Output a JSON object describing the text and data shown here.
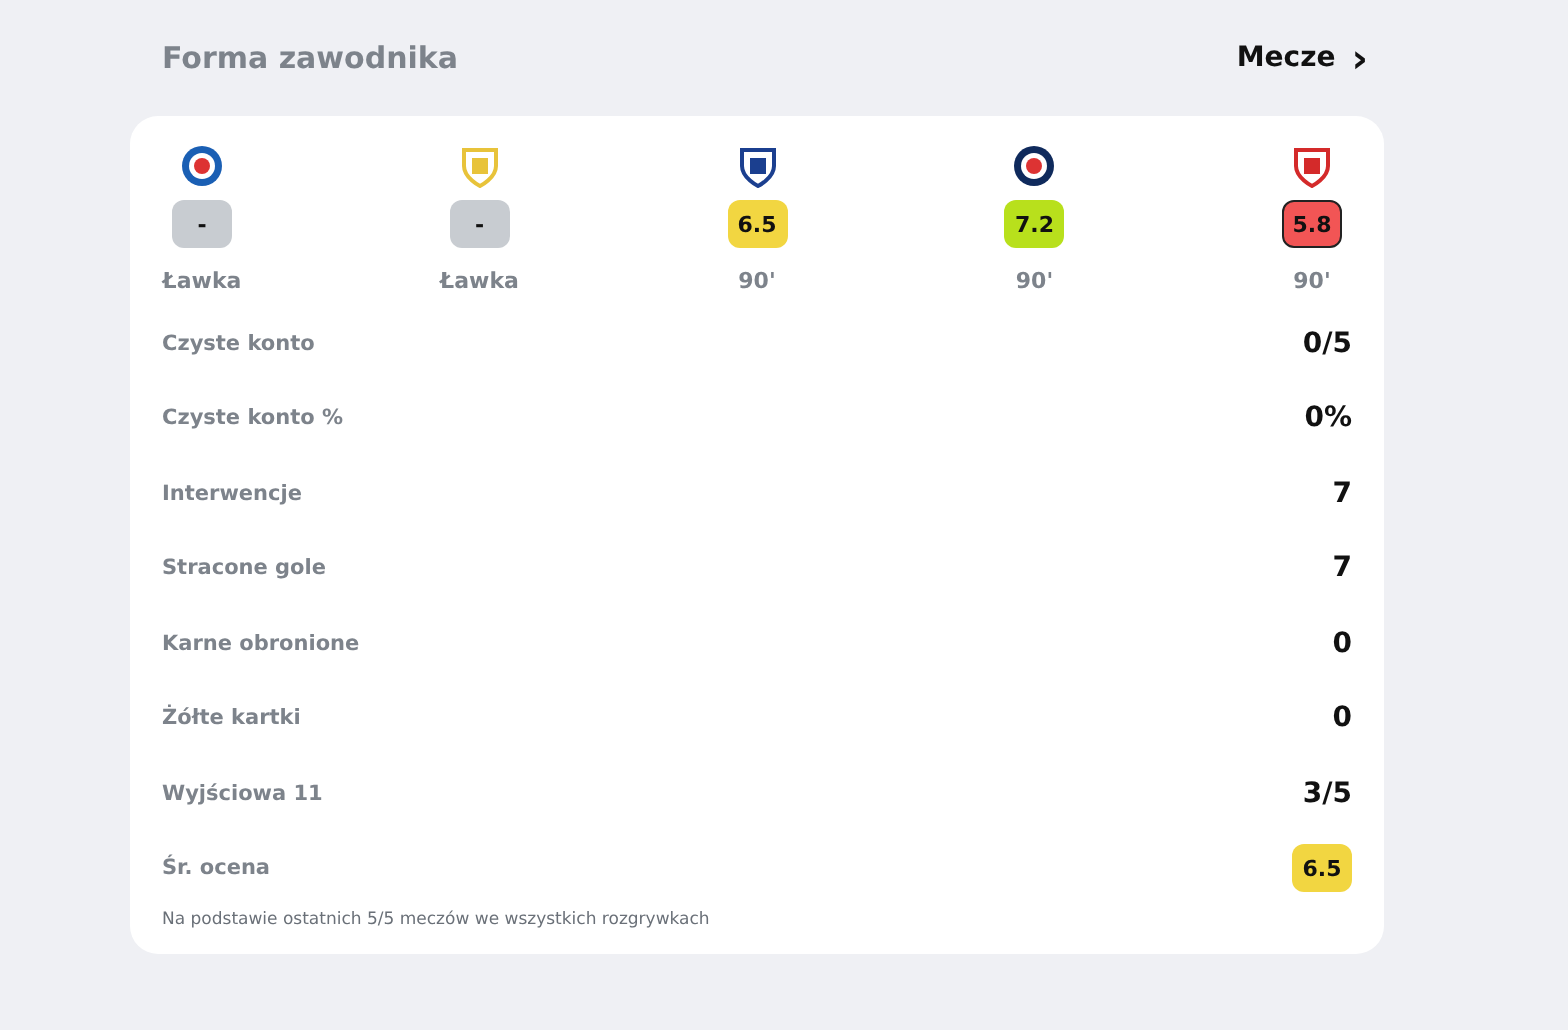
{
  "title": "Forma zawodnika",
  "link": {
    "label": "Mecze",
    "icon": "›"
  },
  "matches": [
    {
      "rating": "-",
      "color": "#c8ccd1",
      "highlighted": false,
      "minutes": "Ławka"
    },
    {
      "rating": "-",
      "color": "#c8ccd1",
      "highlighted": false,
      "minutes": "Ławka"
    },
    {
      "rating": "6.5",
      "color": "#f2d641",
      "highlighted": false,
      "minutes": "90'"
    },
    {
      "rating": "7.2",
      "color": "#b8e01c",
      "highlighted": false,
      "minutes": "90'"
    },
    {
      "rating": "5.8",
      "color": "#f25555",
      "highlighted": true,
      "minutes": "90'"
    }
  ],
  "stats": [
    {
      "label": "Czyste konto",
      "value": "0/5",
      "kind": "text"
    },
    {
      "label": "Czyste konto %",
      "value": "0%",
      "kind": "text"
    },
    {
      "label": "Interwencje",
      "value": "7",
      "kind": "text"
    },
    {
      "label": "Stracone gole",
      "value": "7",
      "kind": "text"
    },
    {
      "label": "Karne obronione",
      "value": "0",
      "kind": "text"
    },
    {
      "label": "Żółte kartki",
      "value": "0",
      "kind": "text"
    },
    {
      "label": "Wyjściowa 11",
      "value": "3/5",
      "kind": "text"
    },
    {
      "label": "Śr. ocena",
      "value": "6.5",
      "kind": "badge",
      "color": "#f2d641"
    }
  ],
  "footnote": "Na podstawie ostatnich 5/5 meczów we wszystkich rozgrywkach"
}
